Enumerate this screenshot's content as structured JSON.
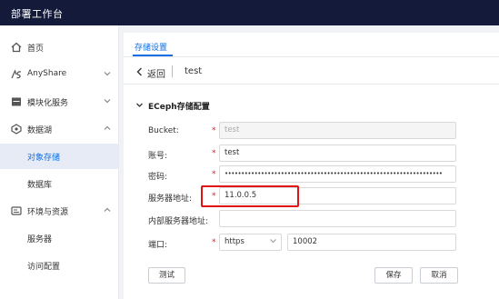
{
  "app": {
    "title": "部署工作台"
  },
  "sidebar": {
    "items": [
      {
        "label": "首页",
        "icon": "home-icon"
      },
      {
        "label": "AnyShare",
        "icon": "anyshare-logo-icon",
        "has_chevron": true
      },
      {
        "label": "模块化服务",
        "icon": "module-icon",
        "has_chevron": true
      },
      {
        "label": "数据湖",
        "icon": "data-lake-icon",
        "has_chevron": true
      },
      {
        "label": "对象存储",
        "active": true
      },
      {
        "label": "数据库"
      },
      {
        "label": "环境与资源",
        "icon": "environment-icon",
        "has_chevron": true
      },
      {
        "label": "服务器"
      },
      {
        "label": "访问配置"
      }
    ]
  },
  "tabs": {
    "active": "存储设置"
  },
  "back": {
    "label": "返回",
    "name": "test"
  },
  "section": {
    "title": "ECeph存储配置"
  },
  "form": {
    "bucket": {
      "label": "Bucket:",
      "value": "test"
    },
    "account": {
      "label": "账号:",
      "value": "test"
    },
    "password": {
      "label": "密码:",
      "value": "••••••••••••••••••••••••••••••••••••••••••••••••••••••••••••••••••"
    },
    "server": {
      "label": "服务器地址:",
      "value": "11.0.0.5"
    },
    "internal_server": {
      "label": "内部服务器地址:",
      "value": ""
    },
    "port": {
      "label": "端口:",
      "protocol": "https",
      "value": "10002"
    }
  },
  "buttons": {
    "test": "测试",
    "save": "保存",
    "cancel": "取消"
  },
  "colors": {
    "topbar": "#131a3a",
    "accent": "#126ee3",
    "highlight": "#e01414",
    "required": "#e02020"
  }
}
